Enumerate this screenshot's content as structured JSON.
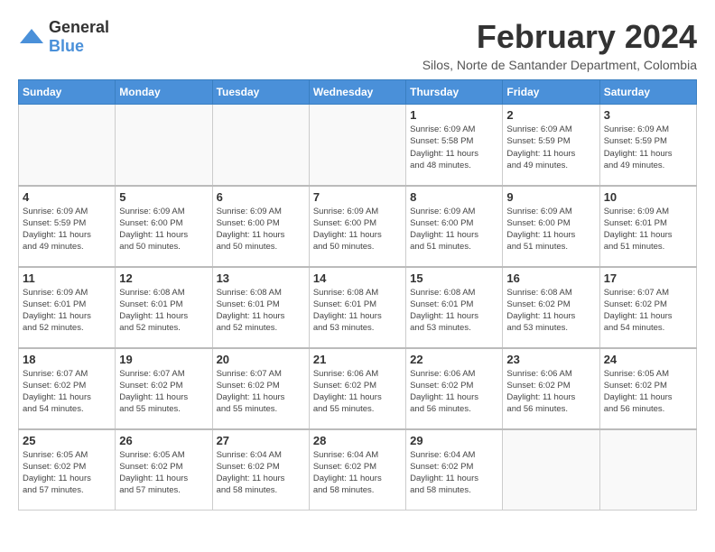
{
  "header": {
    "logo_general": "General",
    "logo_blue": "Blue",
    "title": "February 2024",
    "location": "Silos, Norte de Santander Department, Colombia"
  },
  "calendar": {
    "days_of_week": [
      "Sunday",
      "Monday",
      "Tuesday",
      "Wednesday",
      "Thursday",
      "Friday",
      "Saturday"
    ],
    "weeks": [
      [
        {
          "day": "",
          "info": ""
        },
        {
          "day": "",
          "info": ""
        },
        {
          "day": "",
          "info": ""
        },
        {
          "day": "",
          "info": ""
        },
        {
          "day": "1",
          "info": "Sunrise: 6:09 AM\nSunset: 5:58 PM\nDaylight: 11 hours\nand 48 minutes."
        },
        {
          "day": "2",
          "info": "Sunrise: 6:09 AM\nSunset: 5:59 PM\nDaylight: 11 hours\nand 49 minutes."
        },
        {
          "day": "3",
          "info": "Sunrise: 6:09 AM\nSunset: 5:59 PM\nDaylight: 11 hours\nand 49 minutes."
        }
      ],
      [
        {
          "day": "4",
          "info": "Sunrise: 6:09 AM\nSunset: 5:59 PM\nDaylight: 11 hours\nand 49 minutes."
        },
        {
          "day": "5",
          "info": "Sunrise: 6:09 AM\nSunset: 6:00 PM\nDaylight: 11 hours\nand 50 minutes."
        },
        {
          "day": "6",
          "info": "Sunrise: 6:09 AM\nSunset: 6:00 PM\nDaylight: 11 hours\nand 50 minutes."
        },
        {
          "day": "7",
          "info": "Sunrise: 6:09 AM\nSunset: 6:00 PM\nDaylight: 11 hours\nand 50 minutes."
        },
        {
          "day": "8",
          "info": "Sunrise: 6:09 AM\nSunset: 6:00 PM\nDaylight: 11 hours\nand 51 minutes."
        },
        {
          "day": "9",
          "info": "Sunrise: 6:09 AM\nSunset: 6:00 PM\nDaylight: 11 hours\nand 51 minutes."
        },
        {
          "day": "10",
          "info": "Sunrise: 6:09 AM\nSunset: 6:01 PM\nDaylight: 11 hours\nand 51 minutes."
        }
      ],
      [
        {
          "day": "11",
          "info": "Sunrise: 6:09 AM\nSunset: 6:01 PM\nDaylight: 11 hours\nand 52 minutes."
        },
        {
          "day": "12",
          "info": "Sunrise: 6:08 AM\nSunset: 6:01 PM\nDaylight: 11 hours\nand 52 minutes."
        },
        {
          "day": "13",
          "info": "Sunrise: 6:08 AM\nSunset: 6:01 PM\nDaylight: 11 hours\nand 52 minutes."
        },
        {
          "day": "14",
          "info": "Sunrise: 6:08 AM\nSunset: 6:01 PM\nDaylight: 11 hours\nand 53 minutes."
        },
        {
          "day": "15",
          "info": "Sunrise: 6:08 AM\nSunset: 6:01 PM\nDaylight: 11 hours\nand 53 minutes."
        },
        {
          "day": "16",
          "info": "Sunrise: 6:08 AM\nSunset: 6:02 PM\nDaylight: 11 hours\nand 53 minutes."
        },
        {
          "day": "17",
          "info": "Sunrise: 6:07 AM\nSunset: 6:02 PM\nDaylight: 11 hours\nand 54 minutes."
        }
      ],
      [
        {
          "day": "18",
          "info": "Sunrise: 6:07 AM\nSunset: 6:02 PM\nDaylight: 11 hours\nand 54 minutes."
        },
        {
          "day": "19",
          "info": "Sunrise: 6:07 AM\nSunset: 6:02 PM\nDaylight: 11 hours\nand 55 minutes."
        },
        {
          "day": "20",
          "info": "Sunrise: 6:07 AM\nSunset: 6:02 PM\nDaylight: 11 hours\nand 55 minutes."
        },
        {
          "day": "21",
          "info": "Sunrise: 6:06 AM\nSunset: 6:02 PM\nDaylight: 11 hours\nand 55 minutes."
        },
        {
          "day": "22",
          "info": "Sunrise: 6:06 AM\nSunset: 6:02 PM\nDaylight: 11 hours\nand 56 minutes."
        },
        {
          "day": "23",
          "info": "Sunrise: 6:06 AM\nSunset: 6:02 PM\nDaylight: 11 hours\nand 56 minutes."
        },
        {
          "day": "24",
          "info": "Sunrise: 6:05 AM\nSunset: 6:02 PM\nDaylight: 11 hours\nand 56 minutes."
        }
      ],
      [
        {
          "day": "25",
          "info": "Sunrise: 6:05 AM\nSunset: 6:02 PM\nDaylight: 11 hours\nand 57 minutes."
        },
        {
          "day": "26",
          "info": "Sunrise: 6:05 AM\nSunset: 6:02 PM\nDaylight: 11 hours\nand 57 minutes."
        },
        {
          "day": "27",
          "info": "Sunrise: 6:04 AM\nSunset: 6:02 PM\nDaylight: 11 hours\nand 58 minutes."
        },
        {
          "day": "28",
          "info": "Sunrise: 6:04 AM\nSunset: 6:02 PM\nDaylight: 11 hours\nand 58 minutes."
        },
        {
          "day": "29",
          "info": "Sunrise: 6:04 AM\nSunset: 6:02 PM\nDaylight: 11 hours\nand 58 minutes."
        },
        {
          "day": "",
          "info": ""
        },
        {
          "day": "",
          "info": ""
        }
      ]
    ]
  }
}
